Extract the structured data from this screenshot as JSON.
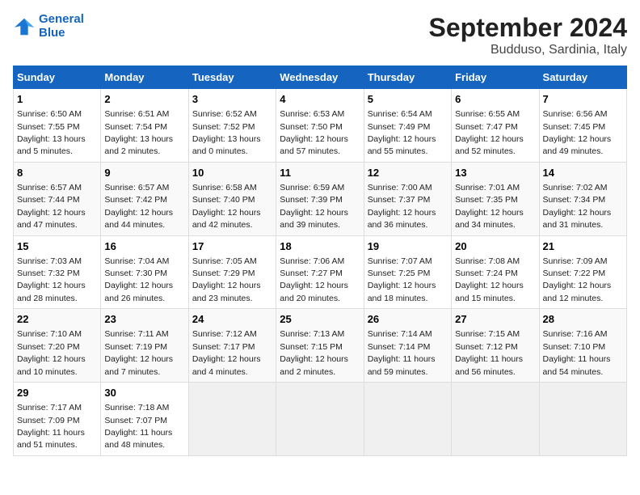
{
  "header": {
    "logo_line1": "General",
    "logo_line2": "Blue",
    "month_year": "September 2024",
    "location": "Budduso, Sardinia, Italy"
  },
  "weekdays": [
    "Sunday",
    "Monday",
    "Tuesday",
    "Wednesday",
    "Thursday",
    "Friday",
    "Saturday"
  ],
  "weeks": [
    [
      {
        "day": 1,
        "sunrise": "6:50 AM",
        "sunset": "7:55 PM",
        "daylight": "13 hours and 5 minutes."
      },
      {
        "day": 2,
        "sunrise": "6:51 AM",
        "sunset": "7:54 PM",
        "daylight": "13 hours and 2 minutes."
      },
      {
        "day": 3,
        "sunrise": "6:52 AM",
        "sunset": "7:52 PM",
        "daylight": "13 hours and 0 minutes."
      },
      {
        "day": 4,
        "sunrise": "6:53 AM",
        "sunset": "7:50 PM",
        "daylight": "12 hours and 57 minutes."
      },
      {
        "day": 5,
        "sunrise": "6:54 AM",
        "sunset": "7:49 PM",
        "daylight": "12 hours and 55 minutes."
      },
      {
        "day": 6,
        "sunrise": "6:55 AM",
        "sunset": "7:47 PM",
        "daylight": "12 hours and 52 minutes."
      },
      {
        "day": 7,
        "sunrise": "6:56 AM",
        "sunset": "7:45 PM",
        "daylight": "12 hours and 49 minutes."
      }
    ],
    [
      {
        "day": 8,
        "sunrise": "6:57 AM",
        "sunset": "7:44 PM",
        "daylight": "12 hours and 47 minutes."
      },
      {
        "day": 9,
        "sunrise": "6:57 AM",
        "sunset": "7:42 PM",
        "daylight": "12 hours and 44 minutes."
      },
      {
        "day": 10,
        "sunrise": "6:58 AM",
        "sunset": "7:40 PM",
        "daylight": "12 hours and 42 minutes."
      },
      {
        "day": 11,
        "sunrise": "6:59 AM",
        "sunset": "7:39 PM",
        "daylight": "12 hours and 39 minutes."
      },
      {
        "day": 12,
        "sunrise": "7:00 AM",
        "sunset": "7:37 PM",
        "daylight": "12 hours and 36 minutes."
      },
      {
        "day": 13,
        "sunrise": "7:01 AM",
        "sunset": "7:35 PM",
        "daylight": "12 hours and 34 minutes."
      },
      {
        "day": 14,
        "sunrise": "7:02 AM",
        "sunset": "7:34 PM",
        "daylight": "12 hours and 31 minutes."
      }
    ],
    [
      {
        "day": 15,
        "sunrise": "7:03 AM",
        "sunset": "7:32 PM",
        "daylight": "12 hours and 28 minutes."
      },
      {
        "day": 16,
        "sunrise": "7:04 AM",
        "sunset": "7:30 PM",
        "daylight": "12 hours and 26 minutes."
      },
      {
        "day": 17,
        "sunrise": "7:05 AM",
        "sunset": "7:29 PM",
        "daylight": "12 hours and 23 minutes."
      },
      {
        "day": 18,
        "sunrise": "7:06 AM",
        "sunset": "7:27 PM",
        "daylight": "12 hours and 20 minutes."
      },
      {
        "day": 19,
        "sunrise": "7:07 AM",
        "sunset": "7:25 PM",
        "daylight": "12 hours and 18 minutes."
      },
      {
        "day": 20,
        "sunrise": "7:08 AM",
        "sunset": "7:24 PM",
        "daylight": "12 hours and 15 minutes."
      },
      {
        "day": 21,
        "sunrise": "7:09 AM",
        "sunset": "7:22 PM",
        "daylight": "12 hours and 12 minutes."
      }
    ],
    [
      {
        "day": 22,
        "sunrise": "7:10 AM",
        "sunset": "7:20 PM",
        "daylight": "12 hours and 10 minutes."
      },
      {
        "day": 23,
        "sunrise": "7:11 AM",
        "sunset": "7:19 PM",
        "daylight": "12 hours and 7 minutes."
      },
      {
        "day": 24,
        "sunrise": "7:12 AM",
        "sunset": "7:17 PM",
        "daylight": "12 hours and 4 minutes."
      },
      {
        "day": 25,
        "sunrise": "7:13 AM",
        "sunset": "7:15 PM",
        "daylight": "12 hours and 2 minutes."
      },
      {
        "day": 26,
        "sunrise": "7:14 AM",
        "sunset": "7:14 PM",
        "daylight": "11 hours and 59 minutes."
      },
      {
        "day": 27,
        "sunrise": "7:15 AM",
        "sunset": "7:12 PM",
        "daylight": "11 hours and 56 minutes."
      },
      {
        "day": 28,
        "sunrise": "7:16 AM",
        "sunset": "7:10 PM",
        "daylight": "11 hours and 54 minutes."
      }
    ],
    [
      {
        "day": 29,
        "sunrise": "7:17 AM",
        "sunset": "7:09 PM",
        "daylight": "11 hours and 51 minutes."
      },
      {
        "day": 30,
        "sunrise": "7:18 AM",
        "sunset": "7:07 PM",
        "daylight": "11 hours and 48 minutes."
      },
      null,
      null,
      null,
      null,
      null
    ]
  ]
}
